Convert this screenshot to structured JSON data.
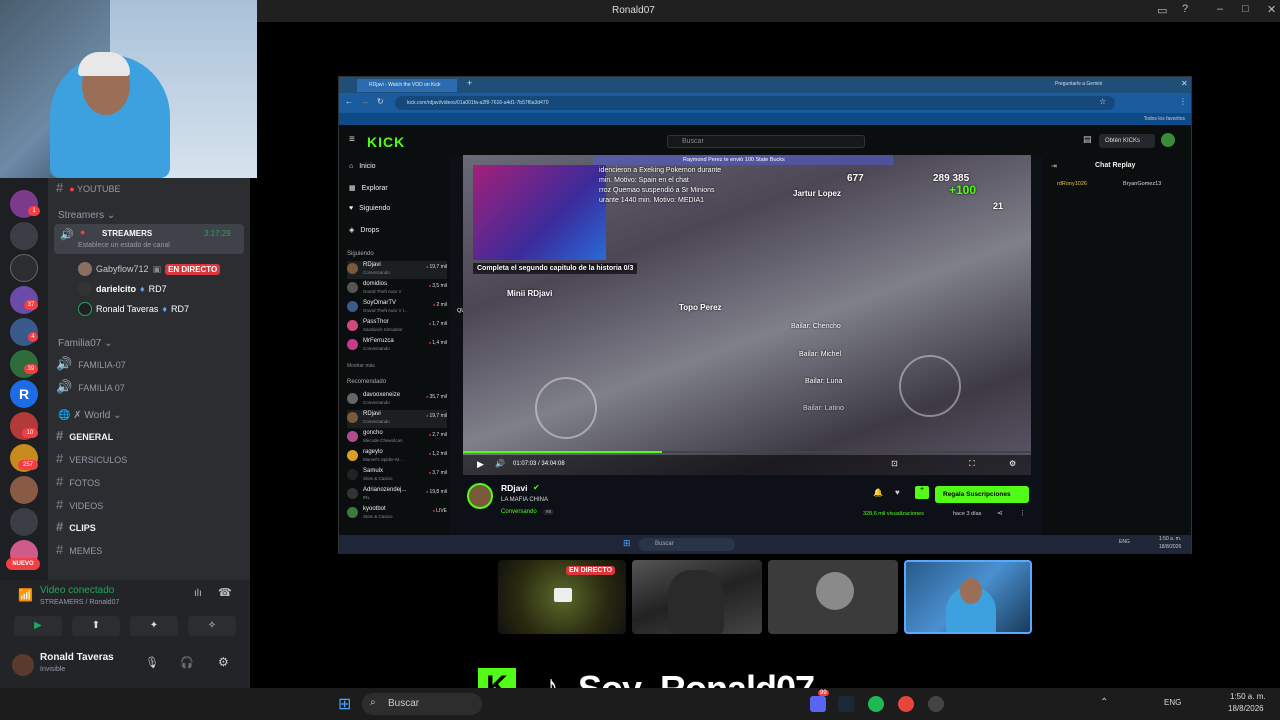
{
  "window_title": "Ronald07",
  "discord": {
    "channels_top": [
      {
        "name": "YOUTUBE"
      }
    ],
    "streamers_category": "Streamers",
    "streamers_channel": "STREAMERS",
    "streamers_timer": "3:17:29",
    "streamers_status": "Establece un estado de canal",
    "voice_users": [
      {
        "name": "Gabyflow712",
        "badge": "EN DIRECTO"
      },
      {
        "name": "darielcito",
        "tag": "RD7"
      },
      {
        "name": "Ronald Taveras",
        "tag": "RD7"
      }
    ],
    "familia_category": "Familia07",
    "familia_channels": [
      "FAMILIA-07",
      "FAMILIA 07"
    ],
    "world_category": "World",
    "world_channels": [
      "GENERAL",
      "VERSICULOS",
      "FOTOS",
      "VIDEOS",
      "CLIPS",
      "MEMES"
    ],
    "server_badges": [
      "1",
      "37",
      "4",
      "39",
      "10",
      "257",
      "NUEVO"
    ],
    "voice_connected": "Video conectado",
    "voice_path": "STREAMERS / Ronald07",
    "user_name": "Ronald Taveras",
    "user_status": "Invisible"
  },
  "browser": {
    "tab_title": "RDjavi - Watch the VOD on Kick",
    "url": "kick.com/rdjavi/videos/01a001fa-a2f8-7616-a4d1-7b57f6a3d470",
    "gemini": "Preguntarle a Gemini",
    "bookmarks_right": "Todos los favoritos"
  },
  "kick": {
    "logo": "KICK",
    "search_placeholder": "Buscar",
    "obtain_button": "Obtén KICKs",
    "nav": [
      {
        "label": "Inicio"
      },
      {
        "label": "Explorar"
      },
      {
        "label": "Siguiendo"
      },
      {
        "label": "Drops"
      }
    ],
    "following_title": "Siguiendo",
    "following": [
      {
        "name": "RDjavi",
        "game": "Conversando",
        "viewers": "19,7 mil"
      },
      {
        "name": "domidios",
        "game": "Grand Theft Auto V",
        "viewers": "3,5 mil"
      },
      {
        "name": "SoyOmarTV",
        "game": "Grand Theft Auto V I...",
        "viewers": "2 mil"
      },
      {
        "name": "PassThor",
        "game": "Sandwich Simulator",
        "viewers": "1,7 mil"
      },
      {
        "name": "MrFerruzca",
        "game": "Conversando",
        "viewers": "1,4 mil"
      }
    ],
    "show_more": "Mostrar más",
    "recommended_title": "Recomendado",
    "recommended": [
      {
        "name": "davooxeneize",
        "game": "Conversando",
        "viewers": "35,7 mil"
      },
      {
        "name": "RDjavi",
        "game": "Conversando",
        "viewers": "19,7 mil"
      },
      {
        "name": "goncho",
        "game": "Mecode Chewolcan",
        "viewers": "2,7 mil"
      },
      {
        "name": "rageylo",
        "game": "Marvel's Spider-M...",
        "viewers": "1,2 mil"
      },
      {
        "name": "Samulx",
        "game": "Slots & Casino",
        "viewers": "3,7 mil"
      },
      {
        "name": "Adrianozendej...",
        "game": "IRL",
        "viewers": "19,8 mil"
      },
      {
        "name": "kyootbot",
        "game": "Slots & Casino",
        "viewers": "LIVE"
      }
    ],
    "tooltip": "QUE PASARA?",
    "video": {
      "overlay_lines": [
        "idencieron a Exeking Pokemon durante",
        "min. Motivo: Spain en el chat",
        "rroz Quemao suspendió a Sr Minions",
        "urante 1440 min. Motivo: MEDIA1"
      ],
      "notification": "Raymond Perez te envió 100 State Bucks",
      "quest": "Completa el segundo capitulo de la historia 0/3",
      "names": [
        "Jartur Lopez",
        "Minii RDjavi",
        "Topo Perez"
      ],
      "counter1": "677",
      "counter2": "289 385",
      "counter3": "+100",
      "counter4": "21",
      "actions": [
        "Bailar: Chencho",
        "Bailar: Michel",
        "Bailar: Luna",
        "Bailar: Latino"
      ],
      "time": "01:07:03 / 34:04:08",
      "progress": 0.35
    },
    "chat_replay": "Chat Replay",
    "chat_users": [
      "rdRony1026",
      "BryanGomez13"
    ],
    "channel": {
      "name": "RDjavi",
      "title": "LA MAFIA CHINA",
      "category": "Conversando",
      "lang": "es",
      "views": "328,6 mil visualizaciones",
      "ago": "hace 3 días",
      "sub_button": "Regala Suscripciones"
    },
    "inner_search": "Buscar",
    "inner_clock": "1:50 a. m.",
    "inner_date": "18/8/2026",
    "inner_lang": "ENG"
  },
  "participants": [
    {
      "label": "EN DIRECTO"
    }
  ],
  "banner": {
    "text": "Soy_Ronald07"
  },
  "taskbar": {
    "search": "Buscar",
    "lang": "ENG",
    "time": "1:50 a. m.",
    "date": "18/8/2026",
    "badge": "99"
  }
}
